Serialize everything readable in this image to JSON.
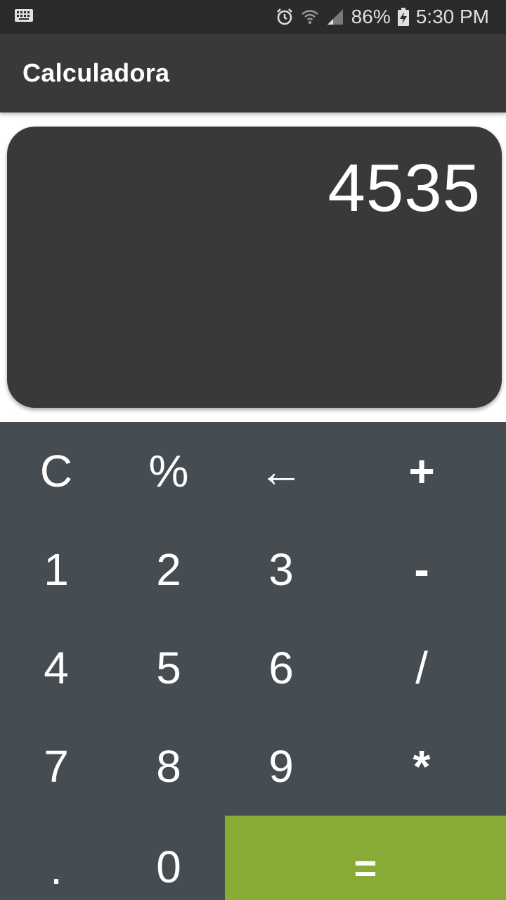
{
  "status_bar": {
    "keyboard_icon": "keyboard-icon",
    "alarm_icon": "alarm-icon",
    "wifi_icon": "wifi-icon",
    "signal_icon": "signal-icon",
    "battery_percent": "86%",
    "battery_icon": "battery-charging-icon",
    "time": "5:30 PM"
  },
  "app_bar": {
    "title": "Calculadora"
  },
  "display": {
    "value": "4535"
  },
  "keypad": {
    "clear": "C",
    "percent": "%",
    "backspace": "←",
    "plus": "+",
    "one": "1",
    "two": "2",
    "three": "3",
    "minus": "-",
    "four": "4",
    "five": "5",
    "six": "6",
    "divide": "/",
    "seven": "7",
    "eight": "8",
    "nine": "9",
    "multiply": "*",
    "decimal": ".",
    "zero": "0",
    "equals": "=",
    "equals_color": "#88ab35",
    "background_color": "#454c52"
  }
}
